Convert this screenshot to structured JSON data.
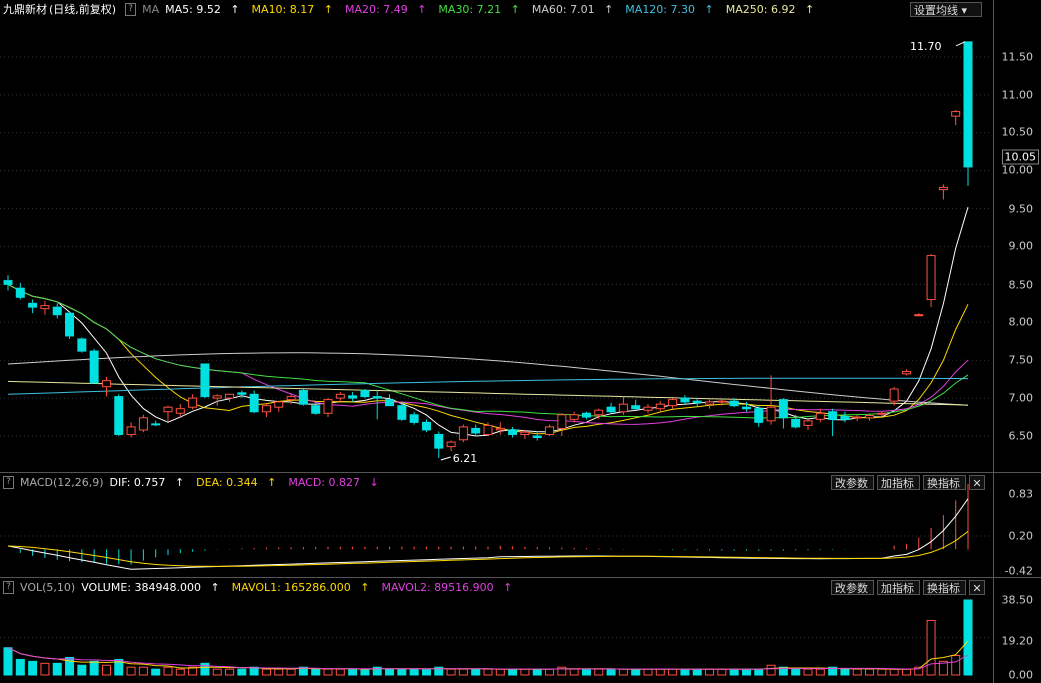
{
  "main": {
    "stock_name": "九鼎新材",
    "period": "(日线,前复权)",
    "ma_label": "MA",
    "ma": [
      {
        "label": "MA5: 9.52",
        "arrow": "↑",
        "color": "#ffffff"
      },
      {
        "label": "MA10: 8.17",
        "arrow": "↑",
        "color": "#ffd800"
      },
      {
        "label": "MA20: 7.49",
        "arrow": "↑",
        "color": "#e040e0"
      },
      {
        "label": "MA30: 7.21",
        "arrow": "↑",
        "color": "#40e040"
      },
      {
        "label": "MA60: 7.01",
        "arrow": "↑",
        "color": "#cccccc"
      },
      {
        "label": "MA120: 7.30",
        "arrow": "↑",
        "color": "#40c0e0"
      },
      {
        "label": "MA250: 6.92",
        "arrow": "↑",
        "color": "#e8e8a0"
      }
    ],
    "settings_button": "设置均线",
    "settings_arrow": "▾",
    "high_label": "11.70",
    "low_label": "6.21",
    "current_price": "10.05",
    "yaxis": [
      "11.50",
      "11.00",
      "10.50",
      "10.00",
      "9.50",
      "9.00",
      "8.50",
      "8.00",
      "7.50",
      "7.00",
      "6.50"
    ]
  },
  "macd": {
    "title": "MACD(12,26,9)",
    "dif": "DIF: 0.757",
    "dif_arrow": "↑",
    "dea": "DEA: 0.344",
    "dea_arrow": "↑",
    "macd": "MACD: 0.827",
    "macd_arrow": "↓",
    "yaxis": [
      "0.83",
      "0.20",
      "-0.42"
    ]
  },
  "vol": {
    "title": "VOL(5,10)",
    "volume": "VOLUME: 384948.000",
    "volume_arrow": "↑",
    "mavol1": "MAVOL1: 165286.000",
    "mavol1_arrow": "↑",
    "mavol2": "MAVOL2: 89516.900",
    "mavol2_arrow": "↑",
    "yaxis": [
      "38.50",
      "19.20",
      "0.00"
    ]
  },
  "buttons": {
    "params": "改参数",
    "add": "加指标",
    "switch": "换指标",
    "close": "✕"
  },
  "colors": {
    "up": "#ff5040",
    "down": "#00e0e0",
    "text": "#cfcfcf"
  },
  "candles": [
    [
      8.55,
      8.62,
      8.42,
      8.5
    ],
    [
      8.45,
      8.52,
      8.3,
      8.33
    ],
    [
      8.25,
      8.3,
      8.12,
      8.2
    ],
    [
      8.18,
      8.28,
      8.1,
      8.22
    ],
    [
      8.2,
      8.25,
      8.05,
      8.1
    ],
    [
      8.12,
      8.15,
      7.78,
      7.82
    ],
    [
      7.78,
      7.8,
      7.6,
      7.62
    ],
    [
      7.62,
      7.65,
      7.2,
      7.2
    ],
    [
      7.15,
      7.28,
      7.02,
      7.23
    ],
    [
      7.02,
      7.05,
      6.5,
      6.52
    ],
    [
      6.52,
      6.68,
      6.48,
      6.62
    ],
    [
      6.58,
      6.78,
      6.55,
      6.74
    ],
    [
      6.66,
      6.7,
      6.63,
      6.65
    ],
    [
      6.82,
      6.9,
      6.7,
      6.88
    ],
    [
      6.8,
      6.92,
      6.75,
      6.86
    ],
    [
      6.88,
      7.05,
      6.85,
      7.0
    ],
    [
      7.45,
      7.45,
      7.0,
      7.02
    ],
    [
      7.0,
      7.05,
      6.9,
      7.03
    ],
    [
      7.0,
      7.06,
      6.95,
      7.05
    ],
    [
      7.07,
      7.1,
      7.0,
      7.05
    ],
    [
      7.05,
      7.1,
      6.8,
      6.82
    ],
    [
      6.82,
      6.92,
      6.75,
      6.9
    ],
    [
      6.88,
      6.96,
      6.82,
      6.95
    ],
    [
      6.98,
      7.05,
      6.92,
      7.02
    ],
    [
      7.1,
      7.12,
      6.9,
      6.92
    ],
    [
      6.9,
      6.95,
      6.78,
      6.8
    ],
    [
      6.8,
      7.0,
      6.75,
      6.98
    ],
    [
      7.0,
      7.08,
      6.95,
      7.05
    ],
    [
      7.03,
      7.08,
      6.95,
      7.0
    ],
    [
      7.1,
      7.12,
      7.0,
      7.02
    ],
    [
      7.02,
      7.1,
      6.72,
      7.0
    ],
    [
      6.98,
      7.05,
      6.9,
      6.9
    ],
    [
      6.9,
      6.95,
      6.7,
      6.72
    ],
    [
      6.78,
      6.82,
      6.65,
      6.68
    ],
    [
      6.68,
      6.72,
      6.55,
      6.58
    ],
    [
      6.52,
      6.56,
      6.21,
      6.34
    ],
    [
      6.36,
      6.44,
      6.3,
      6.42
    ],
    [
      6.45,
      6.65,
      6.42,
      6.62
    ],
    [
      6.6,
      6.65,
      6.5,
      6.54
    ],
    [
      6.52,
      6.68,
      6.5,
      6.64
    ],
    [
      6.58,
      6.68,
      6.52,
      6.6
    ],
    [
      6.58,
      6.62,
      6.48,
      6.52
    ],
    [
      6.52,
      6.58,
      6.46,
      6.55
    ],
    [
      6.5,
      6.56,
      6.44,
      6.48
    ],
    [
      6.52,
      6.65,
      6.5,
      6.62
    ],
    [
      6.6,
      6.8,
      6.5,
      6.78
    ],
    [
      6.72,
      6.82,
      6.68,
      6.78
    ],
    [
      6.8,
      6.82,
      6.72,
      6.75
    ],
    [
      6.78,
      6.86,
      6.72,
      6.84
    ],
    [
      6.88,
      6.94,
      6.8,
      6.82
    ],
    [
      6.82,
      7.02,
      6.78,
      6.92
    ],
    [
      6.9,
      6.98,
      6.84,
      6.86
    ],
    [
      6.84,
      6.92,
      6.8,
      6.88
    ],
    [
      6.86,
      6.96,
      6.82,
      6.92
    ],
    [
      6.9,
      7.0,
      6.86,
      6.98
    ],
    [
      7.0,
      7.04,
      6.92,
      6.95
    ],
    [
      6.96,
      7.0,
      6.88,
      6.94
    ],
    [
      6.92,
      6.98,
      6.86,
      6.95
    ],
    [
      6.95,
      6.98,
      6.9,
      6.96
    ],
    [
      6.96,
      7.0,
      6.88,
      6.9
    ],
    [
      6.88,
      6.95,
      6.82,
      6.86
    ],
    [
      6.86,
      6.9,
      6.62,
      6.68
    ],
    [
      6.7,
      7.3,
      6.65,
      6.88
    ],
    [
      6.98,
      7.0,
      6.6,
      6.74
    ],
    [
      6.72,
      6.78,
      6.6,
      6.62
    ],
    [
      6.64,
      6.72,
      6.58,
      6.7
    ],
    [
      6.72,
      6.86,
      6.68,
      6.8
    ],
    [
      6.82,
      6.86,
      6.5,
      6.72
    ],
    [
      6.76,
      6.82,
      6.68,
      6.72
    ],
    [
      6.74,
      6.78,
      6.7,
      6.75
    ],
    [
      6.74,
      6.8,
      6.7,
      6.77
    ],
    [
      6.8,
      6.82,
      6.76,
      6.8
    ],
    [
      6.96,
      7.15,
      6.9,
      7.12
    ],
    [
      7.32,
      7.38,
      7.3,
      7.35
    ],
    [
      8.1,
      8.12,
      8.08,
      8.1
    ],
    [
      8.3,
      8.9,
      8.2,
      8.88
    ],
    [
      9.75,
      9.82,
      9.62,
      9.78
    ],
    [
      10.72,
      10.8,
      10.6,
      10.78
    ],
    [
      11.7,
      11.7,
      9.8,
      10.05
    ]
  ],
  "volumes": [
    14,
    8,
    7,
    6,
    6,
    9,
    5,
    7,
    5,
    8,
    4,
    4,
    3,
    4,
    3,
    4,
    6,
    3,
    3,
    3,
    4,
    3,
    3,
    3,
    4,
    3,
    3,
    3,
    3,
    3,
    4,
    3,
    3,
    3,
    3,
    4,
    3,
    3,
    3,
    3,
    3,
    3,
    3,
    3,
    3,
    4,
    3,
    3,
    3,
    3,
    3,
    3,
    3,
    3,
    3,
    3,
    3,
    3,
    3,
    3,
    3,
    3,
    5,
    4,
    3,
    3,
    3,
    4,
    3,
    3,
    3,
    3,
    3,
    3,
    4,
    28,
    7,
    10,
    38.5
  ]
}
